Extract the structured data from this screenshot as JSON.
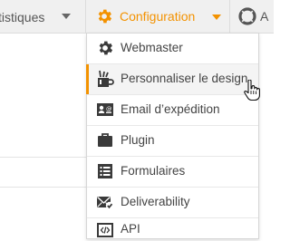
{
  "colors": {
    "accent": "#f39200",
    "text": "#444444",
    "icon": "#3a3a3a"
  },
  "navbar": {
    "statistics": {
      "label": "tistiques",
      "icon": "chevron-down-icon"
    },
    "configuration": {
      "label": "Configuration",
      "icon": "gear-icon"
    },
    "next": {
      "label": "A",
      "icon": "lifebuoy-icon"
    }
  },
  "menu": {
    "items": [
      {
        "label": "Webmaster",
        "icon": "gear-icon"
      },
      {
        "label": "Personnaliser le design",
        "icon": "paint-brushes-icon",
        "active": true
      },
      {
        "label": "Email d’expédition",
        "icon": "contact-card-icon"
      },
      {
        "label": "Plugin",
        "icon": "briefcase-icon"
      },
      {
        "label": "Formulaires",
        "icon": "form-list-icon"
      },
      {
        "label": "Deliverability",
        "icon": "envelope-check-icon"
      },
      {
        "label": "API",
        "icon": "code-icon"
      }
    ]
  }
}
